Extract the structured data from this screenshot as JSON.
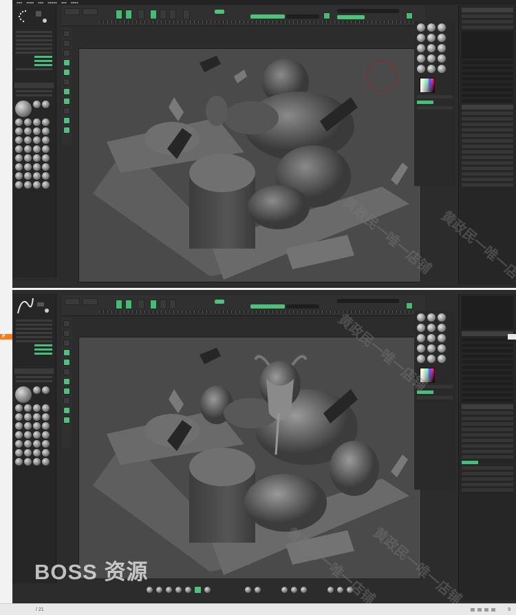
{
  "watermark": {
    "brand": "BOSS 资源",
    "seller": "黄政民一唯一店铺"
  },
  "statusbar": {
    "page_indicator": "/ 21",
    "zoom": "9"
  },
  "orange_tab": {
    "label": "P"
  },
  "colors": {
    "ui_dark": "#2c2c2c",
    "accent_green": "#4dc27c",
    "viewport": "#4a4a4a",
    "pdf_orange": "#ff7a1a"
  },
  "panes": {
    "top": {
      "model_state": "base mesh"
    },
    "bottom": {
      "model_state": "sculpted character"
    }
  }
}
